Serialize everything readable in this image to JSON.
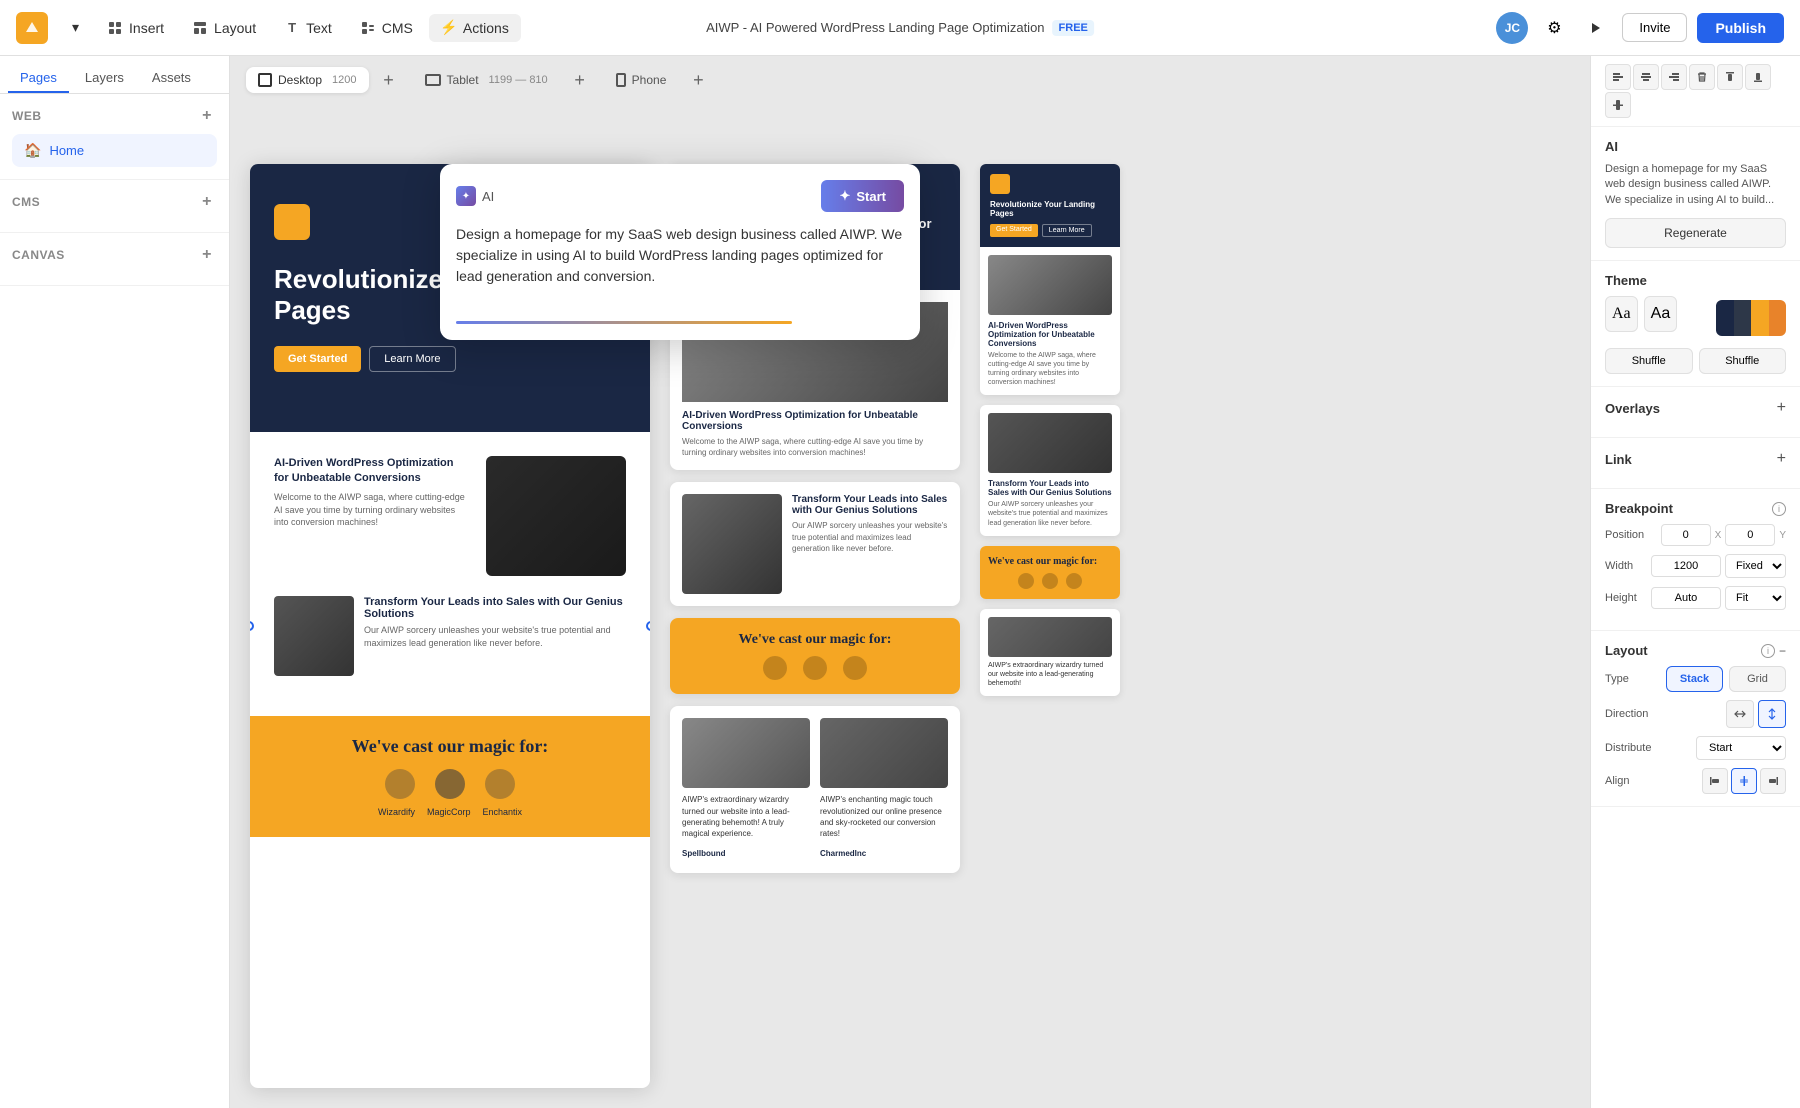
{
  "topbar": {
    "logo_text": "A",
    "insert_label": "Insert",
    "layout_label": "Layout",
    "text_label": "Text",
    "cms_label": "CMS",
    "actions_label": "Actions",
    "page_title": "AIWP - AI Powered WordPress Landing Page Optimization",
    "free_badge": "FREE",
    "invite_label": "Invite",
    "publish_label": "Publish",
    "user_initials": "JC"
  },
  "sidebar": {
    "tabs": [
      {
        "id": "pages",
        "label": "Pages",
        "active": true
      },
      {
        "id": "layers",
        "label": "Layers",
        "active": false
      },
      {
        "id": "assets",
        "label": "Assets",
        "active": false
      }
    ],
    "sections": [
      {
        "title": "Web",
        "items": [
          {
            "label": "Home",
            "icon": "home",
            "active": true
          }
        ]
      },
      {
        "title": "CMS",
        "items": []
      },
      {
        "title": "Canvas",
        "items": []
      }
    ]
  },
  "viewports": [
    {
      "id": "desktop",
      "label": "Desktop",
      "size": "1200",
      "active": true
    },
    {
      "id": "tablet",
      "label": "Tablet",
      "size": "1199 — 810",
      "active": false
    },
    {
      "id": "phone",
      "label": "Phone",
      "size": "",
      "active": false
    }
  ],
  "ai_popup": {
    "badge_label": "AI",
    "start_label": "Start",
    "textarea_value": "Design a homepage for my SaaS web design business called AIWP. We specialize in using AI to build WordPress landing pages optimized for lead generation and conversion."
  },
  "right_panel": {
    "ai_section": {
      "title": "AI",
      "description": "Design a homepage for my SaaS web design business called AIWP. We specialize in using AI to build...",
      "regenerate_label": "Regenerate"
    },
    "theme_section": {
      "title": "Theme",
      "font_option1": "Aa",
      "font_option2": "Aa",
      "shuffle1_label": "Shuffle",
      "shuffle2_label": "Shuffle"
    },
    "overlays_section": {
      "title": "Overlays"
    },
    "link_section": {
      "title": "Link"
    },
    "breakpoint_section": {
      "title": "Breakpoint",
      "position_label": "Position",
      "position_x": "0",
      "position_x_label": "X",
      "position_y": "0",
      "position_y_label": "Y",
      "width_label": "Width",
      "width_value": "1200",
      "width_mode": "Fixed",
      "height_label": "Height",
      "height_value": "Auto",
      "height_mode": "Fit"
    },
    "layout_section": {
      "title": "Layout",
      "type_label": "Type",
      "stack_label": "Stack",
      "grid_label": "Grid",
      "direction_label": "Direction",
      "distribute_label": "Distribute",
      "distribute_value": "Start",
      "align_label": "Align"
    }
  },
  "canvas": {
    "hero_title": "Revolutionize Your Landing Pages",
    "hero_cta1": "Get Started",
    "hero_cta2": "Learn More",
    "section1_title": "AI-Driven WordPress Optimization for Unbeatable Conversions",
    "section1_body": "Welcome to the AIWP saga, where cutting-edge AI save you time by turning ordinary websites into conversion machines!",
    "section2_title": "Transform Your Leads into Sales with Our Genius Solutions",
    "section2_body": "Our AIWP sorcery unleashes your website's true potential and maximizes lead generation like never before.",
    "magic_title": "We've cast our magic for:",
    "magic_label1": "Wizardify",
    "magic_label2": "MagicCorp",
    "magic_label3": "Enchantix",
    "testimonial1_text": "AIWP's extraordinary wizardry turned our website into a lead-generating behemoth! A truly magical experience.",
    "testimonial1_author": "Spellbound",
    "testimonial2_text": "AIWP's enchanting magic touch revolutionized our online presence and sky-rocketed our conversion rates!",
    "testimonial2_author": "CharmedInc"
  },
  "align_icons": [
    "⊢",
    "⊣",
    "↕",
    "↔",
    "↨",
    "⊥"
  ],
  "colors": {
    "primary_blue": "#2563eb",
    "brand_orange": "#f5a623",
    "navy": "#1a2744",
    "swatch1": "#1a2744",
    "swatch2": "#2d3748",
    "swatch3": "#f5a623",
    "swatch4": "#e8832a"
  }
}
